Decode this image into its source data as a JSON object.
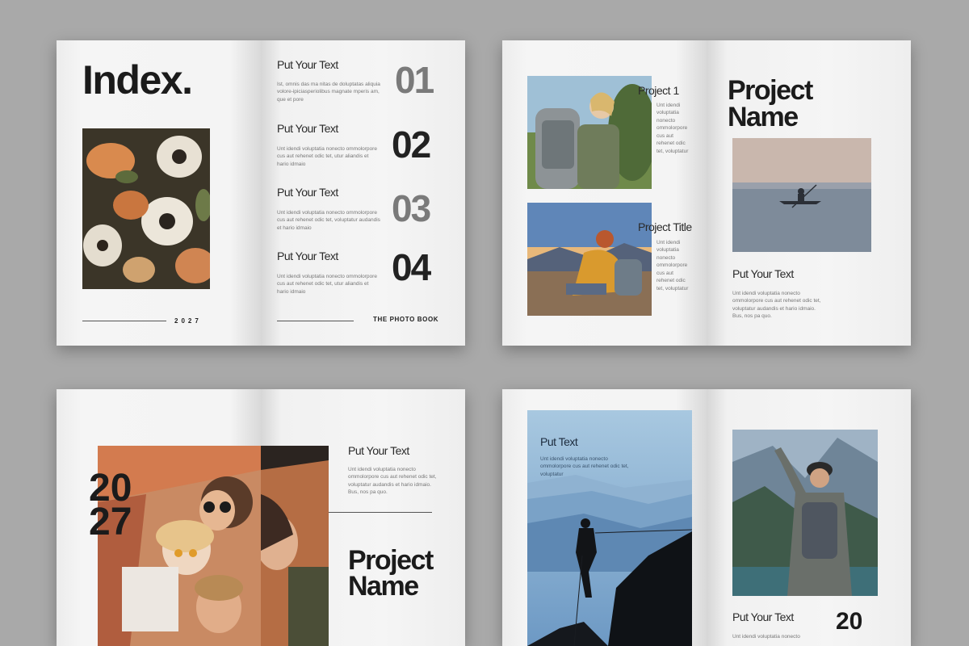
{
  "spread1": {
    "title": "Index.",
    "year": "2027",
    "footer": "THE PHOTO BOOK",
    "entries": [
      {
        "heading": "Put Your Text",
        "body": "Ist, omnis das ma nitas de doluptatas aliquia volore-ipiciasperiolibus magnate mperis am, que et pore",
        "number": "01",
        "color": "#7a7a7a"
      },
      {
        "heading": "Put Your Text",
        "body": "Unt idendi voluptatia nonecto ommolorpore cus aut rehenet odic tet, utur aliandis et hario idmaio",
        "number": "02",
        "color": "#222222"
      },
      {
        "heading": "Put Your Text",
        "body": "Unt idendi voluptatia nonecto ommolorpore cus aut rehenet odic tet, voluptatur audandis et hario idmaio",
        "number": "03",
        "color": "#7a7a7a"
      },
      {
        "heading": "Put Your Text",
        "body": "Unt idendi voluptatia nonecto ommolorpore cus aut rehenet odic tet, utur aliandis et hario idmaio",
        "number": "04",
        "color": "#222222"
      }
    ]
  },
  "spread2": {
    "project1": {
      "title": "Project 1",
      "body": "Unt idendi voluptatia nonecto ommolorpore cus aut rehenet odic tet, voluptatur"
    },
    "project2": {
      "title": "Project Title",
      "body": "Unt idendi voluptatia nonecto ommolorpore cus aut rehenet odic tet, voluptatur"
    },
    "heading_line1": "Project",
    "heading_line2": "Name",
    "subheading": "Put Your Text",
    "body": "Unt idendi voluptatia nonecto ommolorpore cus aut rehenet odic tet, voluptatur audandis et hario idmaio. Bus, nos pa quo."
  },
  "spread3": {
    "year_line1": "20",
    "year_line2": "27",
    "subheading": "Put Your Text",
    "body": "Unt idendi voluptatia nonecto ommolorpore cus aut rehenet odic tet, voluptatur audandis et hario idmaio. Bus, nos pa quo.",
    "heading_line1": "Project",
    "heading_line2": "Name"
  },
  "spread4": {
    "overlay_heading": "Put Text",
    "overlay_body": "Unt idendi voluptatia nonecto ommolorpore cus aut rehenet odic tet, voluptatur",
    "subheading": "Put Your Text",
    "body": "Unt idendi voluptatia nonecto",
    "year_partial": "20"
  },
  "colors": {
    "background": "#a9a9a9",
    "paper": "#f3f3f3",
    "ink": "#1b1b1b",
    "gray_number": "#7a7a7a"
  }
}
